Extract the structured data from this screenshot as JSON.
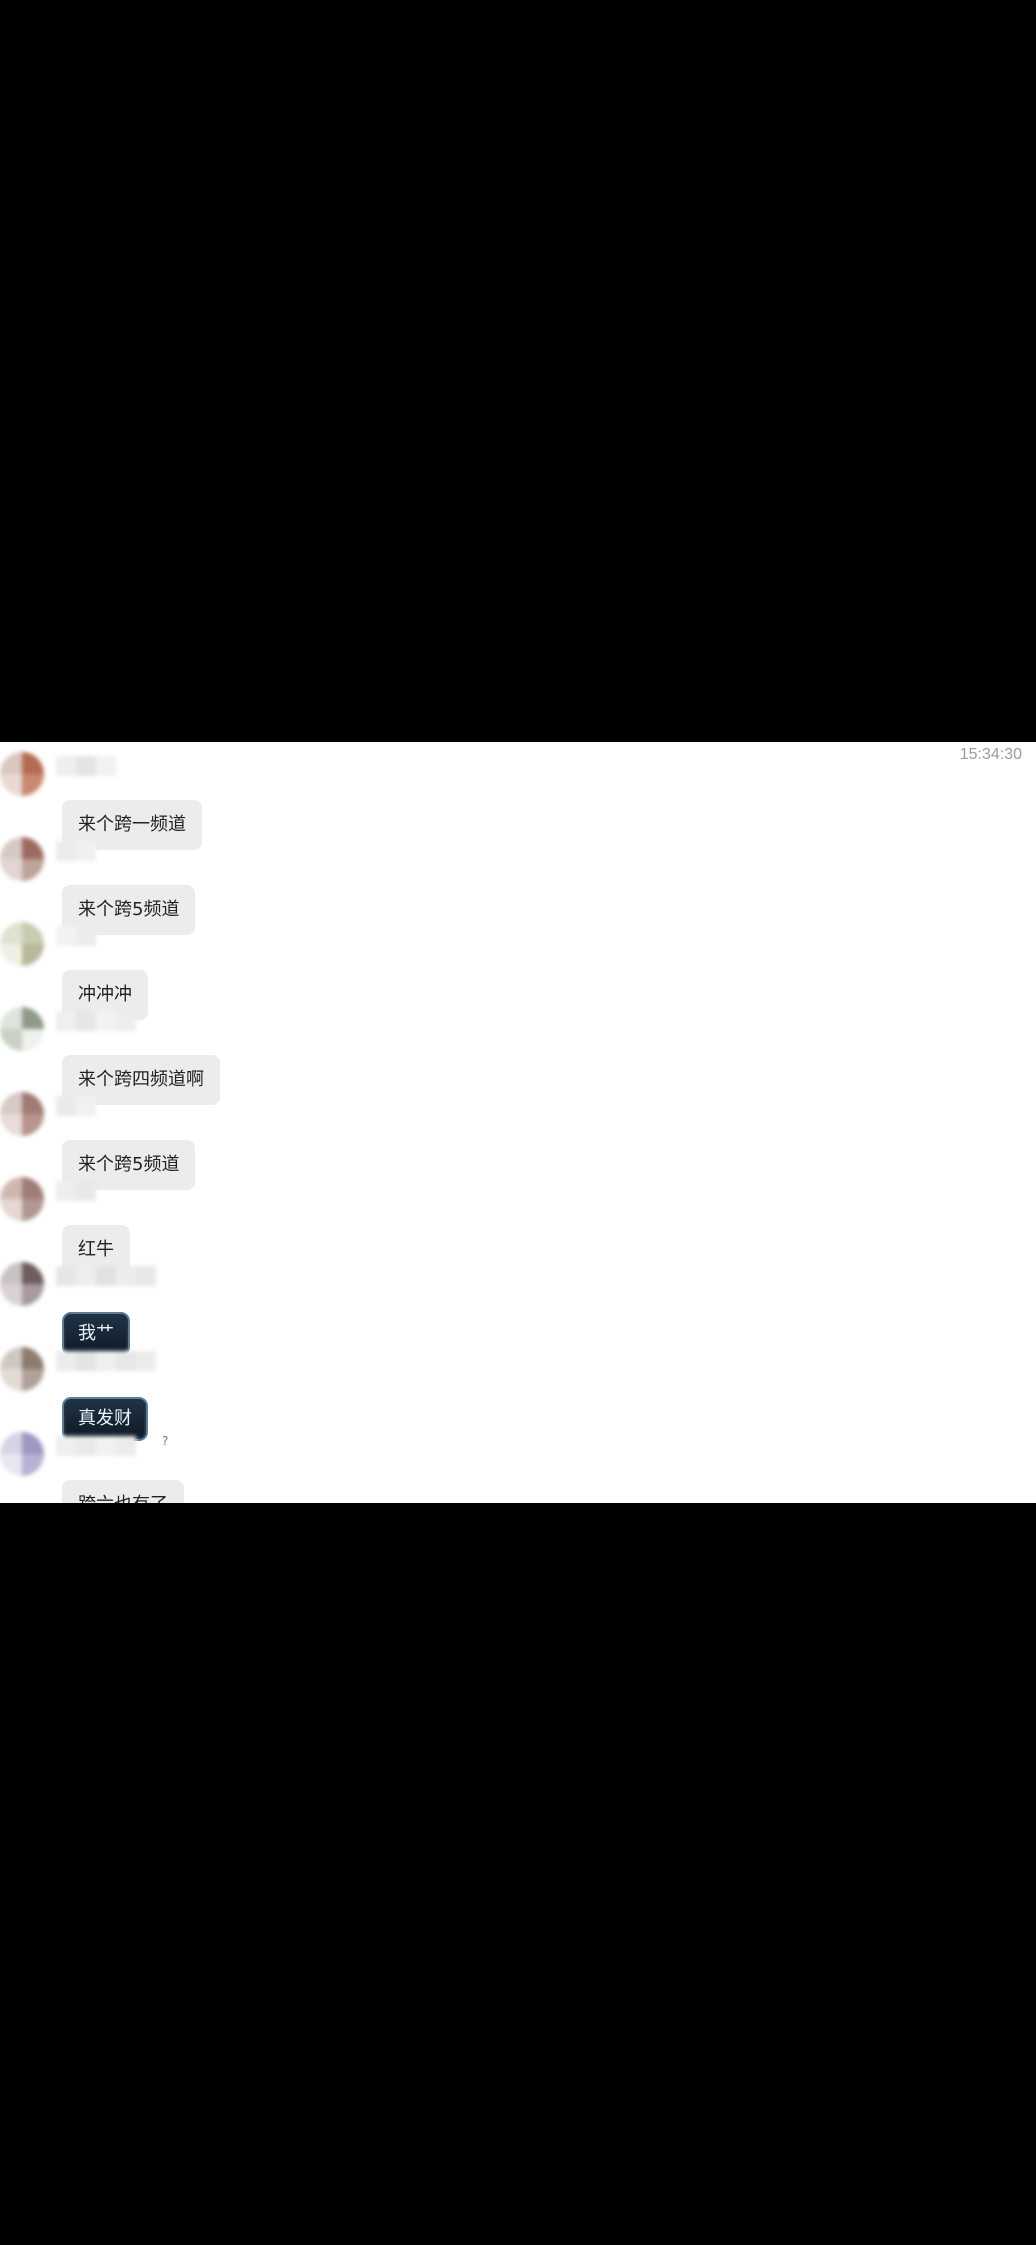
{
  "chat": {
    "timestamp": "15:34:30",
    "messages": [
      {
        "text": "来个跨一频道",
        "style": "normal",
        "avatar_colors": [
          "#d9c7c0",
          "#b56a52",
          "#e9d9d2",
          "#c98870"
        ]
      },
      {
        "text": "来个跨5频道",
        "style": "normal",
        "avatar_colors": [
          "#d8c8c3",
          "#9c6a62",
          "#e3d5d1",
          "#bfa39c"
        ]
      },
      {
        "text": "冲冲冲",
        "style": "normal",
        "avatar_colors": [
          "#dfe2cf",
          "#c8cdb1",
          "#eef0e4",
          "#b7b99a"
        ]
      },
      {
        "text": "来个跨四频道啊",
        "style": "normal",
        "avatar_colors": [
          "#dfe3dd",
          "#8f9a88",
          "#c9d1c5",
          "#eef1ec"
        ]
      },
      {
        "text": "来个跨5频道",
        "style": "normal",
        "avatar_colors": [
          "#d7c9c6",
          "#a07b74",
          "#e8dcda",
          "#b9948d"
        ]
      },
      {
        "text": "红牛",
        "style": "normal",
        "avatar_colors": [
          "#cfb7b1",
          "#9e7d76",
          "#e6d7d4",
          "#b19892"
        ]
      },
      {
        "text": "我艹",
        "style": "special",
        "avatar_colors": [
          "#c9c2c4",
          "#6e5c5e",
          "#d9d1d3",
          "#a89b9d"
        ]
      },
      {
        "text": "真发财",
        "style": "special",
        "avatar_colors": [
          "#cfc8c2",
          "#8c7b6e",
          "#e2dbd5",
          "#b0a297"
        ]
      },
      {
        "text": "跨六也有了",
        "style": "normal",
        "avatar_colors": [
          "#d7d3e6",
          "#9f97c0",
          "#e9e6f2",
          "#b8b1d3"
        ],
        "nickname_suffix": "?"
      }
    ]
  }
}
